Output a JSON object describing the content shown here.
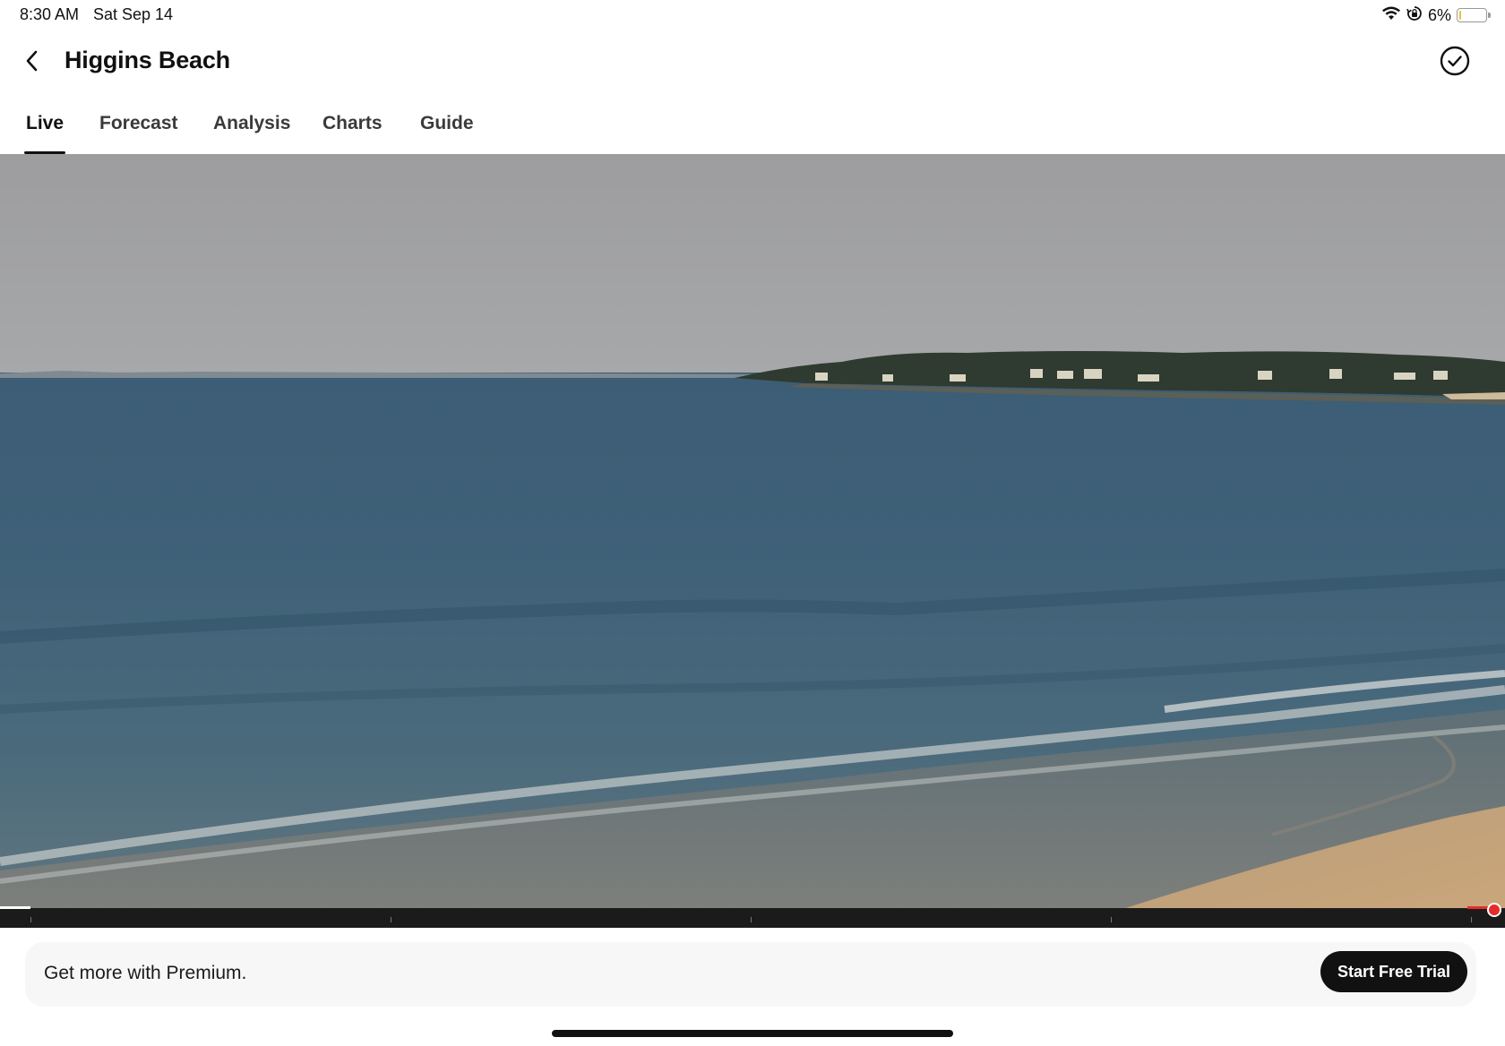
{
  "status_bar": {
    "time": "8:30 AM",
    "date": "Sat Sep 14",
    "battery_percent": "6%",
    "battery_level": 0.06,
    "icons": [
      "wifi-icon",
      "orientation-lock-icon",
      "battery-icon"
    ]
  },
  "header": {
    "title": "Higgins Beach",
    "back_icon": "chevron-left-icon",
    "favorite_icon": "check-circle-icon"
  },
  "tabs": [
    {
      "label": "Live",
      "active": true
    },
    {
      "label": "Forecast",
      "active": false
    },
    {
      "label": "Analysis",
      "active": false
    },
    {
      "label": "Charts",
      "active": false
    },
    {
      "label": "Guide",
      "active": false
    }
  ],
  "player": {
    "progress": 1.0,
    "accent_color": "#e62b2b"
  },
  "promo": {
    "text": "Get more with Premium.",
    "button_label": "Start Free Trial"
  }
}
